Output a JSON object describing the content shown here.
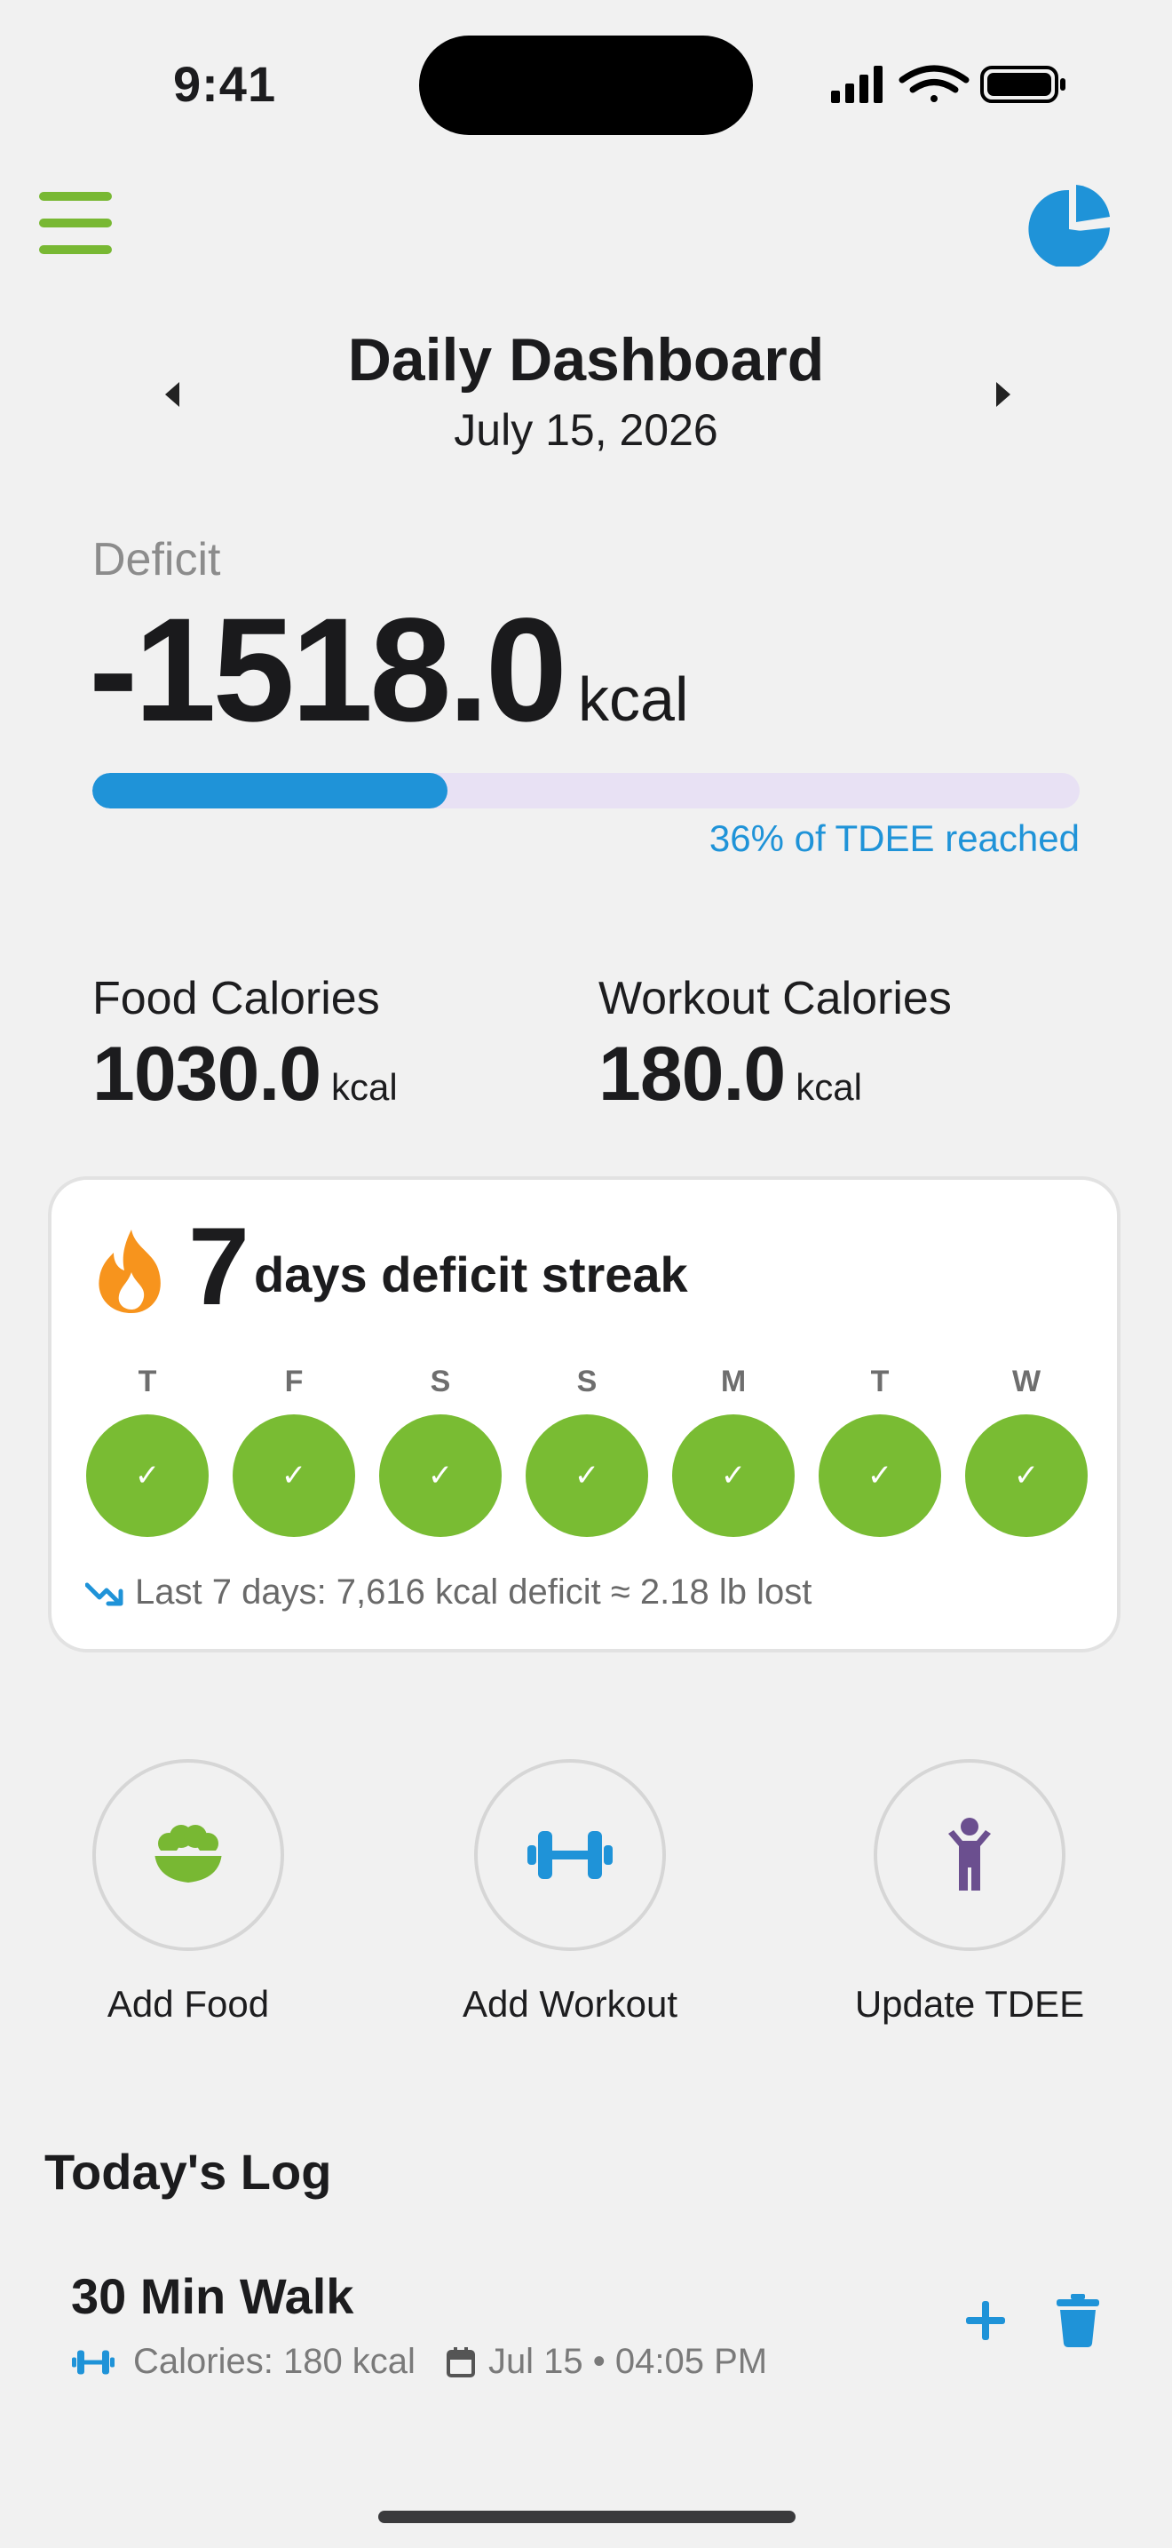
{
  "status_bar": {
    "time": "9:41"
  },
  "header": {
    "title": "Daily Dashboard",
    "date": "July 15, 2026"
  },
  "deficit": {
    "label": "Deficit",
    "value": "-1518.0",
    "unit": "kcal",
    "progress_fraction": 0.36,
    "progress_text": "36% of TDEE reached"
  },
  "food": {
    "label": "Food Calories",
    "value": "1030.0",
    "unit": "kcal"
  },
  "workout": {
    "label": "Workout Calories",
    "value": "180.0",
    "unit": "kcal"
  },
  "streak": {
    "count": "7",
    "text": "days deficit streak",
    "days": [
      {
        "letter": "T",
        "done": true
      },
      {
        "letter": "F",
        "done": true
      },
      {
        "letter": "S",
        "done": true
      },
      {
        "letter": "S",
        "done": true
      },
      {
        "letter": "M",
        "done": true
      },
      {
        "letter": "T",
        "done": true
      },
      {
        "letter": "W",
        "done": true
      }
    ],
    "check": "✓",
    "summary": "Last 7 days: 7,616 kcal deficit ≈ 2.18 lb lost"
  },
  "actions": {
    "add_food": "Add Food",
    "add_workout": "Add Workout",
    "update_tdee": "Update TDEE"
  },
  "log": {
    "title": "Today's Log",
    "items": [
      {
        "name": "30 Min Walk",
        "calories": "Calories: 180 kcal",
        "datetime": "Jul 15 • 04:05 PM"
      }
    ]
  },
  "colors": {
    "accent_green": "#78b833",
    "accent_blue": "#1f93d8",
    "flame_orange": "#f7941d",
    "purple": "#6b4f8f"
  },
  "icons": {
    "menu": "hamburger-icon",
    "stats": "pie-chart-icon",
    "streak": "flame-icon",
    "food": "bowl-icon",
    "workout": "dumbbell-icon",
    "tdee": "person-icon",
    "trend": "trending-down-icon"
  }
}
